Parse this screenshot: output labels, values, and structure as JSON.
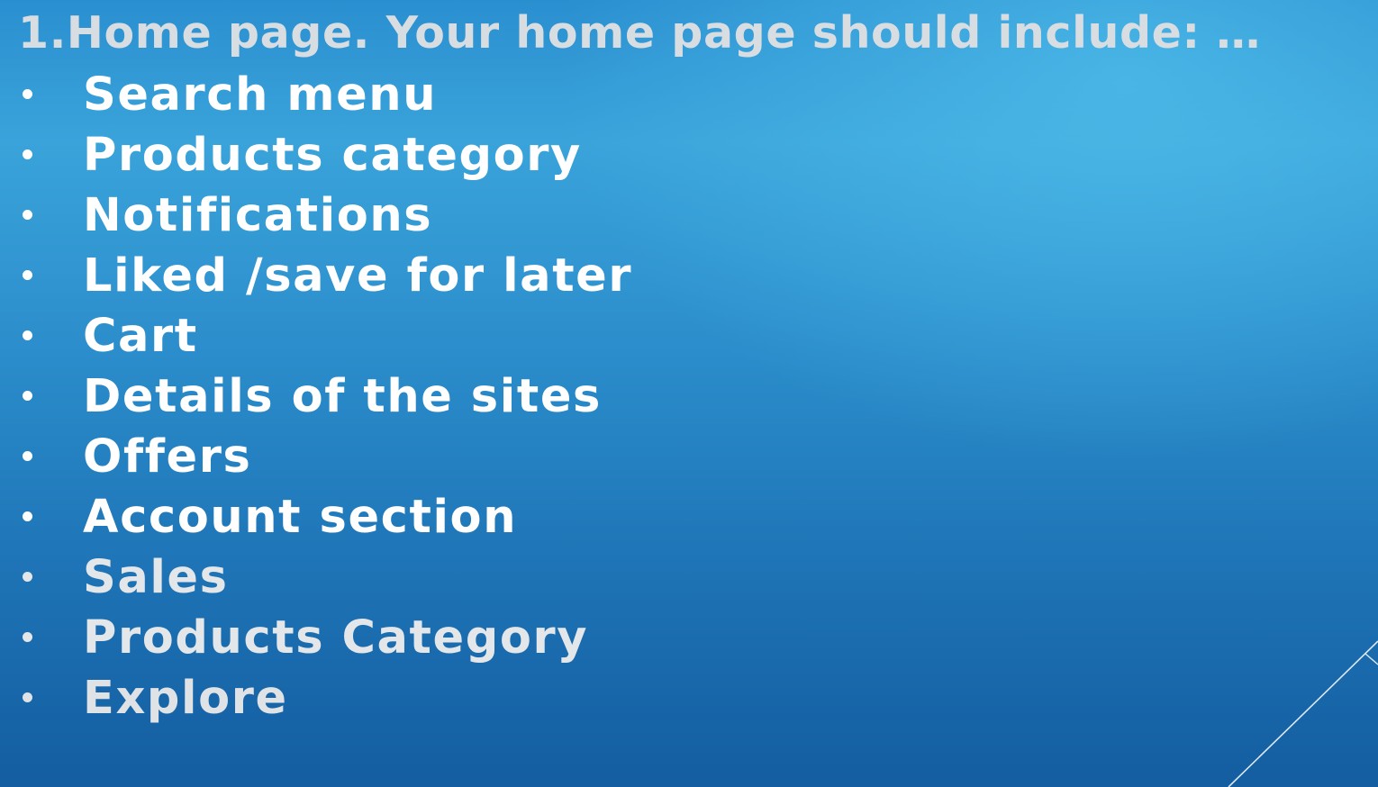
{
  "slide": {
    "title": "1.Home page. Your home page should include: …",
    "title_color": "#d8dde2",
    "bullets": [
      {
        "text": "Search menu",
        "color": "#ffffff"
      },
      {
        "text": "Products category",
        "color": "#ffffff"
      },
      {
        "text": "Notifications",
        "color": "#ffffff"
      },
      {
        "text": "Liked /save for later",
        "color": "#ffffff"
      },
      {
        "text": "Cart",
        "color": "#ffffff"
      },
      {
        "text": "Details of the  sites",
        "color": "#ffffff"
      },
      {
        "text": "Offers",
        "color": "#ffffff"
      },
      {
        "text": "Account section",
        "color": "#ffffff"
      },
      {
        "text": "Sales",
        "color": "#e4e7ea"
      },
      {
        "text": "Products Category",
        "color": "#e4e7ea"
      },
      {
        "text": "Explore",
        "color": "#dfe3e6"
      }
    ]
  },
  "theme": {
    "background_top": "#3aa3da",
    "background_bottom": "#135da0",
    "accent_line": "#dce8f2"
  }
}
